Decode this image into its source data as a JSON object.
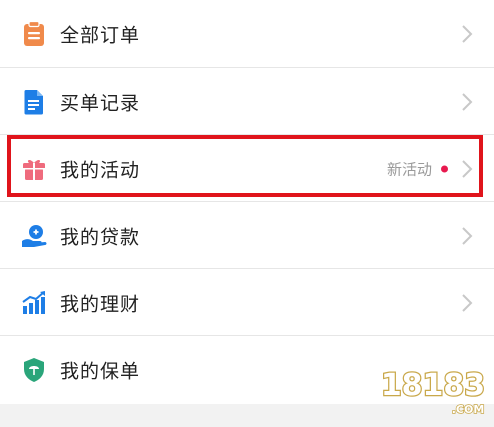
{
  "menu": {
    "items": [
      {
        "label": "全部订单",
        "icon": "clipboard-icon",
        "color": "#f08a4b"
      },
      {
        "label": "买单记录",
        "icon": "document-icon",
        "color": "#1e7ee6"
      },
      {
        "label": "我的活动",
        "icon": "gift-icon",
        "color": "#ef6b7d",
        "meta": "新活动",
        "badge": "dot"
      },
      {
        "label": "我的贷款",
        "icon": "loan-hand-icon",
        "color": "#1e7ee6"
      },
      {
        "label": "我的理财",
        "icon": "bar-chart-icon",
        "color": "#1e7ee6"
      },
      {
        "label": "我的保单",
        "icon": "shield-icon",
        "color": "#2aa57a"
      }
    ]
  },
  "highlight_color": "#e0141b",
  "watermark": {
    "text": "18183",
    "sub": ".COM"
  }
}
